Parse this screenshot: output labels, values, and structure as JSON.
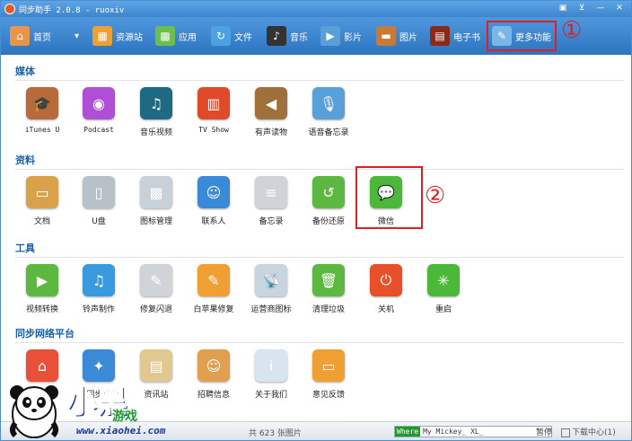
{
  "window": {
    "title": "同步助手 2.0.8 - ruoxiv",
    "controls": [
      "▣",
      "⊻",
      "—",
      "✕"
    ]
  },
  "toolbar": {
    "items": [
      {
        "label": "首页",
        "icon": "home-icon",
        "color": "#e8944a",
        "glyph": "⌂"
      },
      {
        "label": "资源站",
        "icon": "shop-icon",
        "color": "#f0a033",
        "glyph": "▦"
      },
      {
        "label": "应用",
        "icon": "apps-icon",
        "color": "#6cbf4a",
        "glyph": "▩"
      },
      {
        "label": "文件",
        "icon": "file-icon",
        "color": "#4aa3e0",
        "glyph": "↻"
      },
      {
        "label": "音乐",
        "icon": "music-icon",
        "color": "#333333",
        "glyph": "♪"
      },
      {
        "label": "影片",
        "icon": "video-icon",
        "color": "#5aa0d8",
        "glyph": "▶"
      },
      {
        "label": "图片",
        "icon": "photo-icon",
        "color": "#c87a3a",
        "glyph": "▬"
      },
      {
        "label": "电子书",
        "icon": "ebook-icon",
        "color": "#8a2a1a",
        "glyph": "▤"
      }
    ],
    "more": {
      "label": "更多功能",
      "icon": "tools-icon",
      "color": "#7ab6e6",
      "glyph": "✎"
    },
    "home_dropdown": "▾"
  },
  "annotations": {
    "one": "①",
    "two": "②"
  },
  "sections": [
    {
      "title": "媒体",
      "apps": [
        {
          "label": "iTunes U",
          "icon": "itunes-u-icon",
          "color": "#b86a3a",
          "glyph": "🎓",
          "mono": true
        },
        {
          "label": "Podcast",
          "icon": "podcast-icon",
          "color": "#b04fd6",
          "glyph": "◉",
          "mono": true
        },
        {
          "label": "音乐视频",
          "icon": "music-video-icon",
          "color": "#1d6a82",
          "glyph": "♫"
        },
        {
          "label": "TV Show",
          "icon": "tv-show-icon",
          "color": "#e04a2a",
          "glyph": "▥",
          "mono": true
        },
        {
          "label": "有声读物",
          "icon": "audiobook-icon",
          "color": "#a0703a",
          "glyph": "◀"
        },
        {
          "label": "语音备忘录",
          "icon": "voice-memo-icon",
          "color": "#5aa0d8",
          "glyph": "🎙"
        }
      ]
    },
    {
      "title": "资料",
      "apps": [
        {
          "label": "文档",
          "icon": "document-icon",
          "color": "#d9a24a",
          "glyph": "▭"
        },
        {
          "label": "U盘",
          "icon": "usb-drive-icon",
          "color": "#b8c0c8",
          "glyph": "▯"
        },
        {
          "label": "图标管理",
          "icon": "icon-manager-icon",
          "color": "#c8d0d8",
          "glyph": "▩"
        },
        {
          "label": "联系人",
          "icon": "contacts-icon",
          "color": "#3a8ad8",
          "glyph": "☺"
        },
        {
          "label": "备忘录",
          "icon": "notes-icon",
          "color": "#d0d4d8",
          "glyph": "≡"
        },
        {
          "label": "备份还原",
          "icon": "backup-restore-icon",
          "color": "#5cb840",
          "glyph": "↺"
        },
        {
          "label": "微信",
          "icon": "wechat-icon",
          "color": "#4cb83a",
          "glyph": "💬"
        }
      ]
    },
    {
      "title": "工具",
      "apps": [
        {
          "label": "视频转换",
          "icon": "video-convert-icon",
          "color": "#5cb840",
          "glyph": "▶"
        },
        {
          "label": "铃声制作",
          "icon": "ringtone-icon",
          "color": "#3a9ae0",
          "glyph": "♫"
        },
        {
          "label": "修复闪退",
          "icon": "repair-crash-icon",
          "color": "#d0d4d8",
          "glyph": "✎"
        },
        {
          "label": "白苹果修复",
          "icon": "white-apple-repair-icon",
          "color": "#f0a033",
          "glyph": "✎"
        },
        {
          "label": "运营商图标",
          "icon": "carrier-icon",
          "color": "#c8d4e0",
          "glyph": "📡"
        },
        {
          "label": "清理垃圾",
          "icon": "clean-trash-icon",
          "color": "#5cb840",
          "glyph": "🗑"
        },
        {
          "label": "关机",
          "icon": "shutdown-icon",
          "color": "#e8502a",
          "glyph": "⏻"
        },
        {
          "label": "重启",
          "icon": "restart-icon",
          "color": "#4cb83a",
          "glyph": "✳"
        }
      ]
    },
    {
      "title": "同步网络平台",
      "apps": [
        {
          "label": "",
          "icon": "home-page-icon",
          "color": "#e8503a",
          "glyph": "⌂"
        },
        {
          "label": "同步推",
          "icon": "tongbu-push-icon",
          "color": "#3a8ad8",
          "glyph": "✦"
        },
        {
          "label": "资讯站",
          "icon": "news-icon",
          "color": "#e0c890",
          "glyph": "▤"
        },
        {
          "label": "招聘信息",
          "icon": "jobs-icon",
          "color": "#e0a050",
          "glyph": "☺"
        },
        {
          "label": "关于我们",
          "icon": "about-icon",
          "color": "#d8e4f0",
          "glyph": "i"
        },
        {
          "label": "意见反馈",
          "icon": "feedback-icon",
          "color": "#f0a033",
          "glyph": "▭"
        }
      ]
    }
  ],
  "status": {
    "count": "共 623 张图片",
    "where": "Where",
    "song": "My Mickey_ XL_",
    "pause": "暂停",
    "download": "下载中心(1)"
  },
  "watermark": {
    "text": "小黑",
    "sub": "游戏",
    "url": "www.xiaohei.com"
  }
}
